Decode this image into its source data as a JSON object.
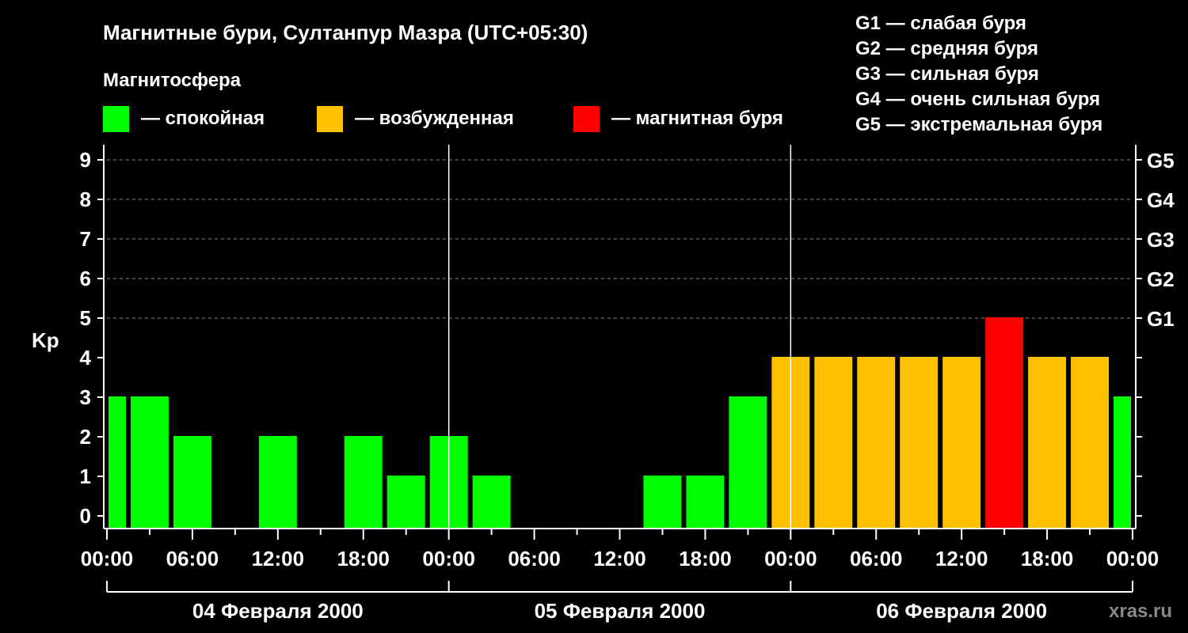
{
  "chart_data": {
    "type": "bar",
    "title": "Магнитные бури, Султанпур Мазра (UTC+05:30)",
    "legend_title": "Магнитосфера",
    "legend": [
      {
        "label": "— спокойная",
        "color": "#00ff00"
      },
      {
        "label": "— возбужденная",
        "color": "#ffc000"
      },
      {
        "label": "— магнитная буря",
        "color": "#ff0000"
      }
    ],
    "g_scale": [
      "G1 — слабая буря",
      "G2 — средняя буря",
      "G3 — сильная буря",
      "G4 — очень сильная буря",
      "G5 — экстремальная буря"
    ],
    "ylabel": "Kp",
    "ylim": [
      0,
      9
    ],
    "yticks": [
      "0",
      "1",
      "2",
      "3",
      "4",
      "5",
      "6",
      "7",
      "8",
      "9"
    ],
    "right_ticks": [
      "G1",
      "G2",
      "G3",
      "G4",
      "G5"
    ],
    "xticks": [
      "00:00",
      "06:00",
      "12:00",
      "18:00",
      "00:00",
      "06:00",
      "12:00",
      "18:00",
      "00:00",
      "06:00",
      "12:00",
      "18:00",
      "00:00"
    ],
    "days": [
      "04 Февраля 2000",
      "05 Февраля 2000",
      "06 Февраля 2000"
    ],
    "bars_note_units": "Kp value per 3-hour interval, x = interval start hour from 04 Feb 00:00 local",
    "bars": [
      {
        "start": -1.5,
        "value": 3,
        "level": "quiet"
      },
      {
        "start": 1.5,
        "value": 3,
        "level": "quiet"
      },
      {
        "start": 4.5,
        "value": 2,
        "level": "quiet"
      },
      {
        "start": 7.5,
        "value": 0,
        "level": "quiet"
      },
      {
        "start": 10.5,
        "value": 2,
        "level": "quiet"
      },
      {
        "start": 13.5,
        "value": 0,
        "level": "quiet"
      },
      {
        "start": 16.5,
        "value": 2,
        "level": "quiet"
      },
      {
        "start": 19.5,
        "value": 1,
        "level": "quiet"
      },
      {
        "start": 22.5,
        "value": 2,
        "level": "quiet"
      },
      {
        "start": 25.5,
        "value": 1,
        "level": "quiet"
      },
      {
        "start": 28.5,
        "value": 0,
        "level": "quiet"
      },
      {
        "start": 31.5,
        "value": 0,
        "level": "quiet"
      },
      {
        "start": 34.5,
        "value": 0,
        "level": "quiet"
      },
      {
        "start": 37.5,
        "value": 1,
        "level": "quiet"
      },
      {
        "start": 40.5,
        "value": 1,
        "level": "quiet"
      },
      {
        "start": 43.5,
        "value": 3,
        "level": "quiet"
      },
      {
        "start": 46.5,
        "value": 4,
        "level": "active"
      },
      {
        "start": 49.5,
        "value": 4,
        "level": "active"
      },
      {
        "start": 52.5,
        "value": 4,
        "level": "active"
      },
      {
        "start": 55.5,
        "value": 4,
        "level": "active"
      },
      {
        "start": 58.5,
        "value": 4,
        "level": "active"
      },
      {
        "start": 61.5,
        "value": 5,
        "level": "storm"
      },
      {
        "start": 64.5,
        "value": 4,
        "level": "active"
      },
      {
        "start": 67.5,
        "value": 4,
        "level": "active"
      },
      {
        "start": 70.5,
        "value": 3,
        "level": "quiet"
      }
    ],
    "colors": {
      "quiet": "#00ff00",
      "active": "#ffc000",
      "storm": "#ff0000"
    },
    "grid": true
  },
  "watermark": "xras.ru"
}
